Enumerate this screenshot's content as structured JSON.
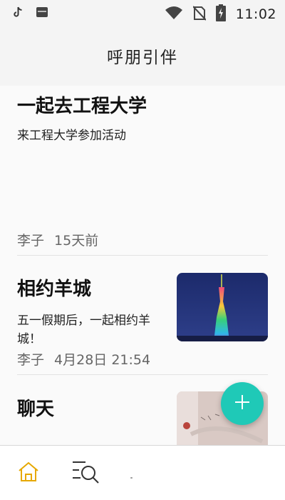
{
  "status_bar": {
    "time": "11:02",
    "icons": [
      "tiktok-icon",
      "app-notification-icon",
      "wifi-icon",
      "no-sim-icon",
      "battery-charging-icon"
    ]
  },
  "app_bar": {
    "title": "呼朋引伴"
  },
  "posts": [
    {
      "title": "一起去工程大学",
      "description": "来工程大学参加活动",
      "author": "李子",
      "time": "15天前",
      "has_image": false
    },
    {
      "title": "相约羊城",
      "description": "五一假期后，一起相约羊城！",
      "author": "李子",
      "time": "4月28日 21:54",
      "has_image": true,
      "image_subject": "canton-tower-night"
    },
    {
      "title": "聊天",
      "has_image": true,
      "image_subject": "photo-thumbnail"
    }
  ],
  "fab": {
    "icon": "plus-icon",
    "color": "#1fc9b7"
  },
  "bottom_nav": {
    "items": [
      {
        "icon": "home-icon",
        "active": true,
        "color": "#e6a800"
      },
      {
        "icon": "search-list-icon",
        "active": false,
        "color": "#333333"
      }
    ]
  }
}
